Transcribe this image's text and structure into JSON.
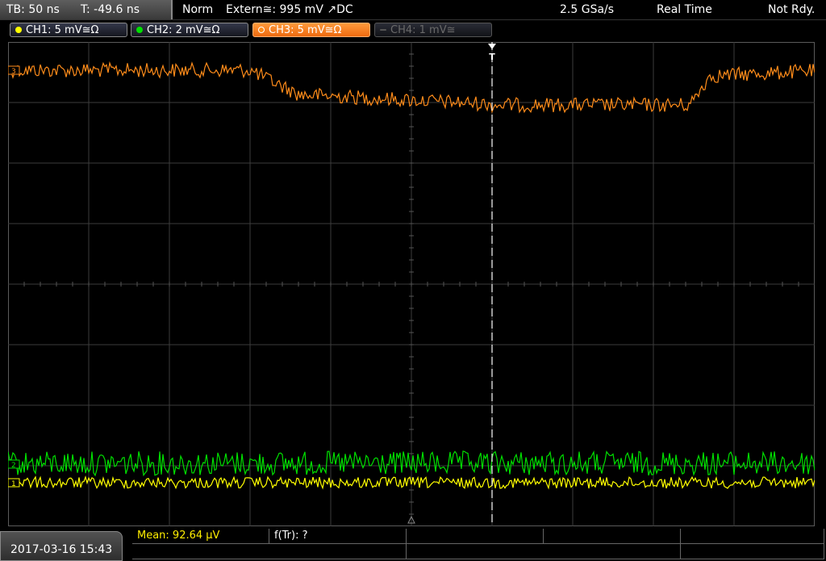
{
  "status": {
    "timebase": "TB: 50 ns",
    "trigger_offset": "T: -49.6 ns",
    "trigger_mode": "Norm",
    "trigger_source": "Extern≅: 995 mV ↗DC",
    "sample_rate": "2.5 GSa/s",
    "acquisition": "Real Time",
    "state": "Not Rdy."
  },
  "channels": [
    {
      "label": "CH1: 5 mV≅Ω",
      "color": "#ffff00",
      "active": false,
      "enabled": true
    },
    {
      "label": "CH2: 2 mV≅Ω",
      "color": "#00e000",
      "active": false,
      "enabled": true
    },
    {
      "label": "CH3: 5 mV≅Ω",
      "color": "#ff8c1a",
      "active": true,
      "enabled": true
    },
    {
      "label": "CH4: 1 mV≅",
      "color": "#6a6a6a",
      "active": false,
      "enabled": false
    }
  ],
  "markers": {
    "ch1": "1",
    "ch2": "2",
    "ch3": "3",
    "trigger": "T"
  },
  "measurements": {
    "mean": "Mean: 92.64 μV",
    "f_tr": "f(Tr): ?"
  },
  "datetime": "2017-03-16 15:43",
  "colors": {
    "ch1": "#ffff00",
    "ch2": "#00e000",
    "ch3": "#ff8c1a",
    "grid": "#444444"
  }
}
